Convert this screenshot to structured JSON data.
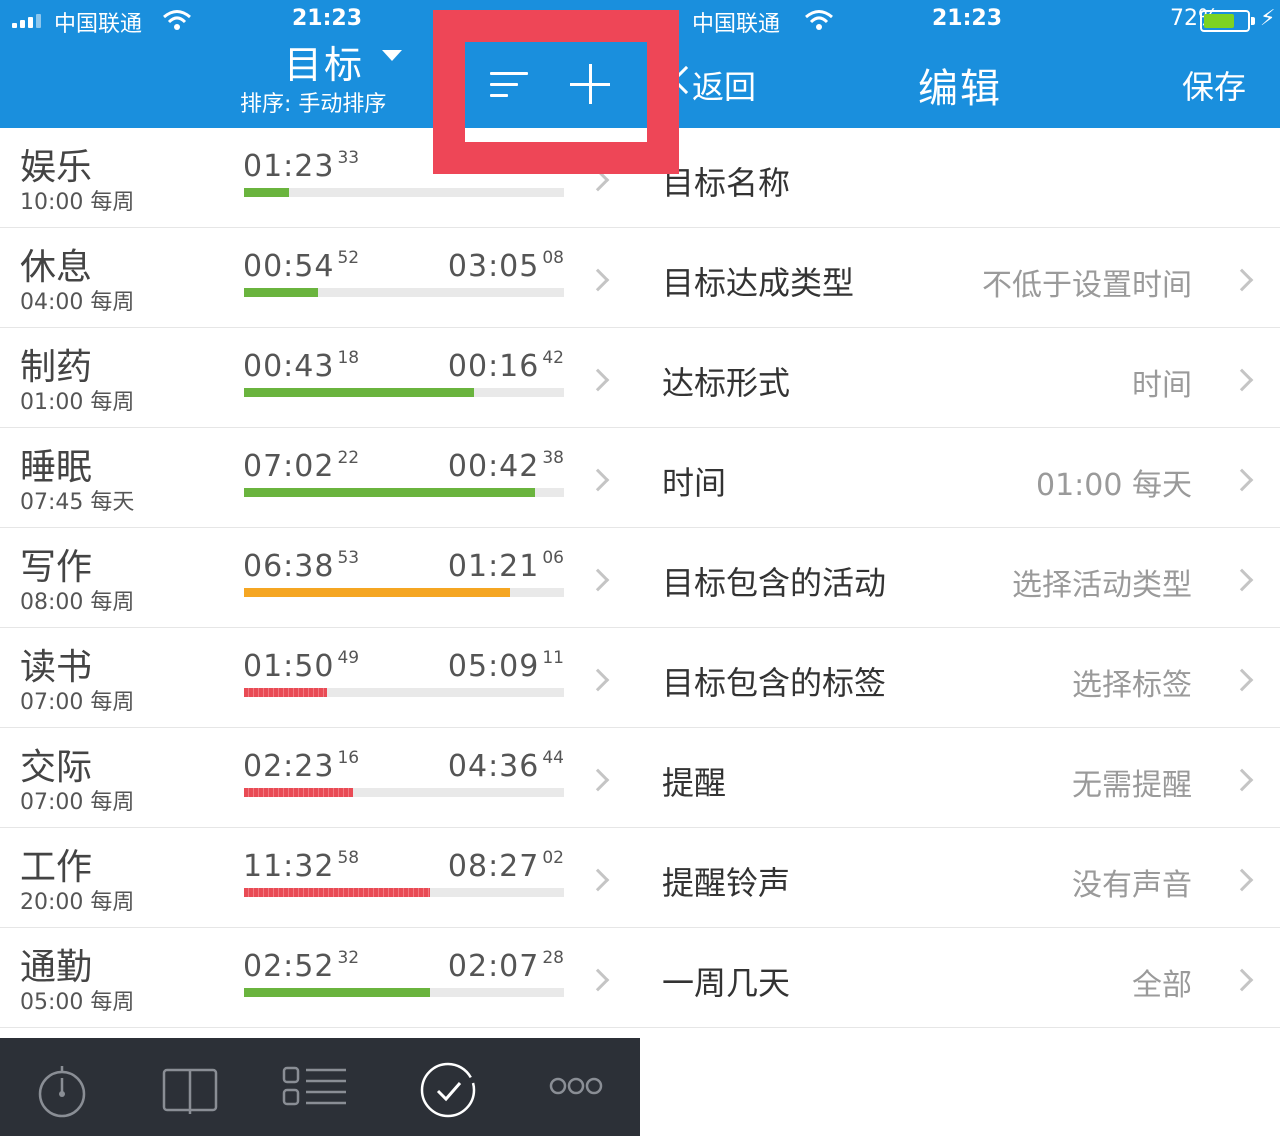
{
  "left_screen": {
    "status": {
      "carrier": "中国联通",
      "time": "21:23"
    },
    "nav": {
      "title": "目标",
      "subtitle": "排序: 手动排序"
    },
    "goals": [
      {
        "name": "娱乐",
        "target": "10:00 每周",
        "done": "01:23",
        "done_sec": "33",
        "left": "",
        "left_sec": "",
        "progress": 0.14,
        "color": "#6ab43e",
        "striped": false
      },
      {
        "name": "休息",
        "target": "04:00 每周",
        "done": "00:54",
        "done_sec": "52",
        "left": "03:05",
        "left_sec": "08",
        "progress": 0.23,
        "color": "#6ab43e",
        "striped": false
      },
      {
        "name": "制药",
        "target": "01:00 每周",
        "done": "00:43",
        "done_sec": "18",
        "left": "00:16",
        "left_sec": "42",
        "progress": 0.72,
        "color": "#6ab43e",
        "striped": false
      },
      {
        "name": "睡眠",
        "target": "07:45 每天",
        "done": "07:02",
        "done_sec": "22",
        "left": "00:42",
        "left_sec": "38",
        "progress": 0.91,
        "color": "#6ab43e",
        "striped": false
      },
      {
        "name": "写作",
        "target": "08:00 每周",
        "done": "06:38",
        "done_sec": "53",
        "left": "01:21",
        "left_sec": "06",
        "progress": 0.83,
        "color": "#f5a623",
        "striped": false
      },
      {
        "name": "读书",
        "target": "07:00 每周",
        "done": "01:50",
        "done_sec": "49",
        "left": "05:09",
        "left_sec": "11",
        "progress": 0.26,
        "color": "#e94b55",
        "striped": true
      },
      {
        "name": "交际",
        "target": "07:00 每周",
        "done": "02:23",
        "done_sec": "16",
        "left": "04:36",
        "left_sec": "44",
        "progress": 0.34,
        "color": "#e94b55",
        "striped": true
      },
      {
        "name": "工作",
        "target": "20:00 每周",
        "done": "11:32",
        "done_sec": "58",
        "left": "08:27",
        "left_sec": "02",
        "progress": 0.58,
        "color": "#e94b55",
        "striped": true
      },
      {
        "name": "通勤",
        "target": "05:00 每周",
        "done": "02:52",
        "done_sec": "32",
        "left": "02:07",
        "left_sec": "28",
        "progress": 0.58,
        "color": "#6ab43e",
        "striped": false
      }
    ],
    "tabs": [
      {
        "icon": "stopwatch-icon",
        "active": false
      },
      {
        "icon": "book-icon",
        "active": false
      },
      {
        "icon": "list-icon",
        "active": false
      },
      {
        "icon": "check-circle-icon",
        "active": true
      },
      {
        "icon": "more-icon",
        "active": false
      }
    ]
  },
  "right_screen": {
    "status": {
      "carrier": "中国联通",
      "time": "21:23",
      "battery": "72%",
      "battery_level": 0.72
    },
    "nav": {
      "back_label": "返回",
      "title": "编辑",
      "save_label": "保存"
    },
    "fields": [
      {
        "label": "目标名称",
        "value": ""
      },
      {
        "label": "目标达成类型",
        "value": "不低于设置时间"
      },
      {
        "label": "达标形式",
        "value": "时间"
      },
      {
        "label": "时间",
        "value": "01:00 每天"
      },
      {
        "label": "目标包含的活动",
        "value": "选择活动类型"
      },
      {
        "label": "目标包含的标签",
        "value": "选择标签"
      },
      {
        "label": "提醒",
        "value": "无需提醒"
      },
      {
        "label": "提醒铃声",
        "value": "没有声音"
      },
      {
        "label": "一周几天",
        "value": "全部"
      }
    ]
  },
  "colors": {
    "nav_blue": "#1a8fdd",
    "highlight_red": "#ee4657",
    "tabbar": "#2c3037"
  }
}
